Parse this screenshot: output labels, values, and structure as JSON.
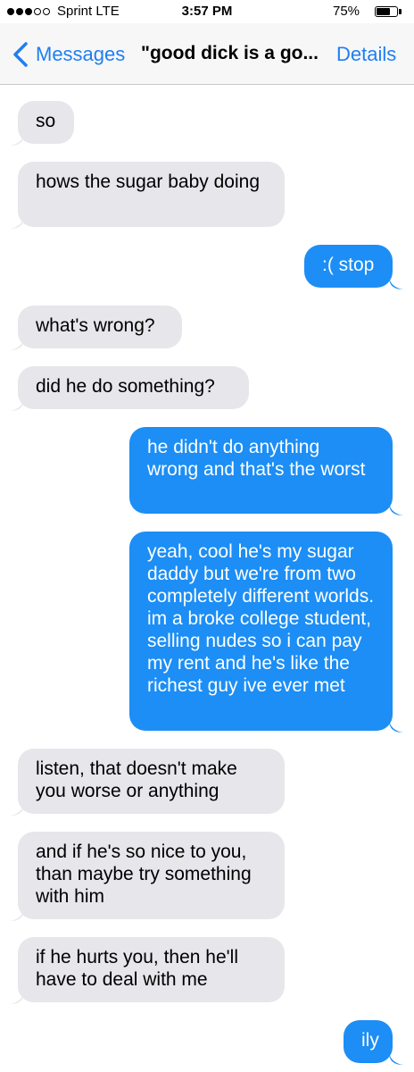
{
  "status_bar": {
    "signal_dots_filled": 3,
    "signal_dots_total": 5,
    "carrier": "Sprint  LTE",
    "time": "3:57 PM",
    "battery_percent": "75%",
    "battery_level": 0.75
  },
  "nav": {
    "back_label": "Messages",
    "title": "\"good dick is a go...",
    "details_label": "Details"
  },
  "colors": {
    "accent": "#1e7ff2",
    "outgoing_bubble": "#1c8ef5",
    "incoming_bubble": "#e6e6eb"
  },
  "messages": [
    {
      "direction": "incoming",
      "text": "so"
    },
    {
      "direction": "incoming",
      "text": "hows the sugar baby doing"
    },
    {
      "direction": "outgoing",
      "text": ":( stop"
    },
    {
      "direction": "incoming",
      "text": "what's wrong?"
    },
    {
      "direction": "incoming",
      "text": "did he do something?"
    },
    {
      "direction": "outgoing",
      "text": "he didn't do anything wrong and that's the worst"
    },
    {
      "direction": "outgoing",
      "text": "yeah, cool he's my sugar daddy but we're from two completely different worlds. im a broke college student, selling nudes so i can pay my rent and he's like the richest guy ive ever met"
    },
    {
      "direction": "incoming",
      "text": "listen, that doesn't make you worse or anything"
    },
    {
      "direction": "incoming",
      "text": "and if he's so nice to you, than maybe try something with him"
    },
    {
      "direction": "incoming",
      "text": "if he hurts you, then he'll have to deal with me"
    },
    {
      "direction": "outgoing",
      "text": "ily"
    }
  ]
}
